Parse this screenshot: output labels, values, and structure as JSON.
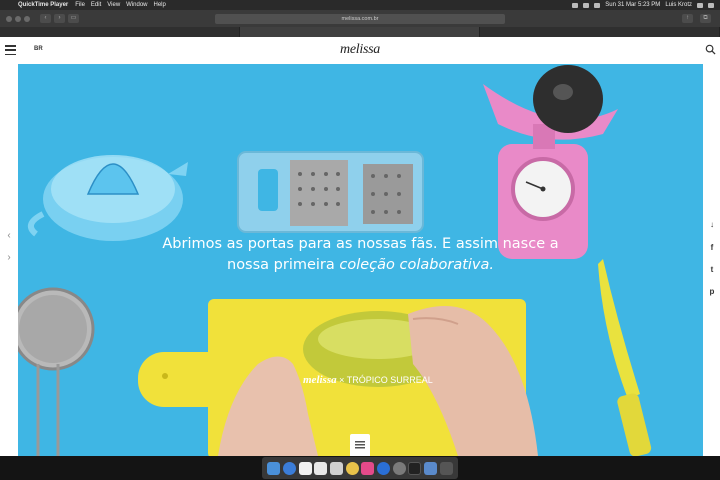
{
  "menubar": {
    "app_name": "QuickTime Player",
    "menus": [
      "File",
      "Edit",
      "View",
      "Window",
      "Help"
    ],
    "datetime": "Sun 31 Mar  5:23 PM",
    "user": "Luis Krotz"
  },
  "browser": {
    "url": "melissa.com.br",
    "tabs": [
      "",
      "",
      ""
    ]
  },
  "site": {
    "lang": "BR",
    "logo": "melissa"
  },
  "hero": {
    "headline_line1": "Abrimos as portas para as nossas fãs. E assim nasce a",
    "headline_line2_strong": "nossa primeira ",
    "headline_line2_emph": "coleção colaborativa.",
    "product_brand": "melissa",
    "product_sep": " × ",
    "product_name": "TRÓPICO SURREAL"
  },
  "colors": {
    "hero_bg": "#3fb6e4",
    "board_yellow": "#f1e13a",
    "scale_pink": "#e98ac8"
  }
}
